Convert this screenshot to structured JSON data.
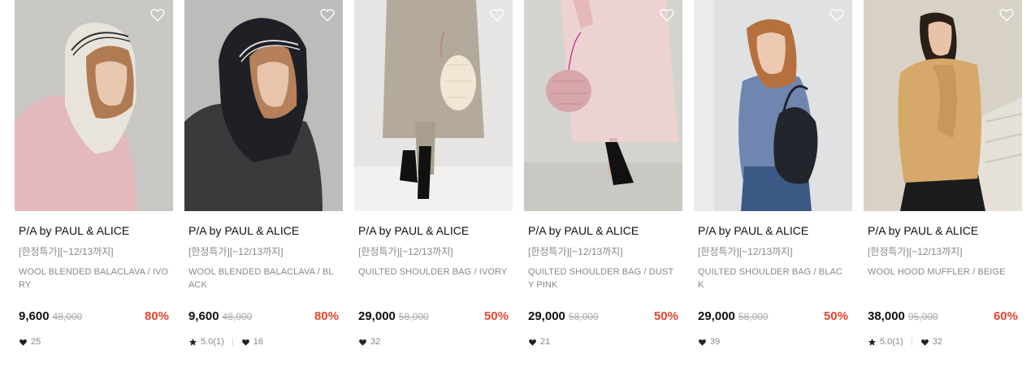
{
  "colors": {
    "discount": "#e8452d",
    "muted": "#888888"
  },
  "products": [
    {
      "brand": "P/A by PAUL & ALICE",
      "tag": "[한정특가][~12/13까지]",
      "name": "WOOL BLENDED BALACLAVA / IVORY",
      "price": "9,600",
      "original_price": "48,000",
      "discount": "80%",
      "rating": "",
      "likes": "25",
      "wishlist_icon": "heart-outline-icon"
    },
    {
      "brand": "P/A by PAUL & ALICE",
      "tag": "[한정특가][~12/13까지]",
      "name": "WOOL BLENDED BALACLAVA / BLACK",
      "price": "9,600",
      "original_price": "48,000",
      "discount": "80%",
      "rating": "5.0(1)",
      "likes": "16",
      "wishlist_icon": "heart-outline-icon"
    },
    {
      "brand": "P/A by PAUL & ALICE",
      "tag": "[한정특가][~12/13까지]",
      "name": "QUILTED SHOULDER BAG / IVORY",
      "price": "29,000",
      "original_price": "58,000",
      "discount": "50%",
      "rating": "",
      "likes": "32",
      "wishlist_icon": "heart-outline-icon"
    },
    {
      "brand": "P/A by PAUL & ALICE",
      "tag": "[한정특가][~12/13까지]",
      "name": "QUILTED SHOULDER BAG / DUSTY PINK",
      "price": "29,000",
      "original_price": "58,000",
      "discount": "50%",
      "rating": "",
      "likes": "21",
      "wishlist_icon": "heart-outline-icon"
    },
    {
      "brand": "P/A by PAUL & ALICE",
      "tag": "[한정특가][~12/13까지]",
      "name": "QUILTED SHOULDER BAG / BLACK",
      "price": "29,000",
      "original_price": "58,000",
      "discount": "50%",
      "rating": "",
      "likes": "39",
      "wishlist_icon": "heart-outline-icon"
    },
    {
      "brand": "P/A by PAUL & ALICE",
      "tag": "[한정특가][~12/13까지]",
      "name": "WOOL HOOD MUFFLER / BEIGE",
      "price": "38,000",
      "original_price": "95,000",
      "discount": "60%",
      "rating": "5.0(1)",
      "likes": "32",
      "wishlist_icon": "heart-outline-icon"
    }
  ]
}
